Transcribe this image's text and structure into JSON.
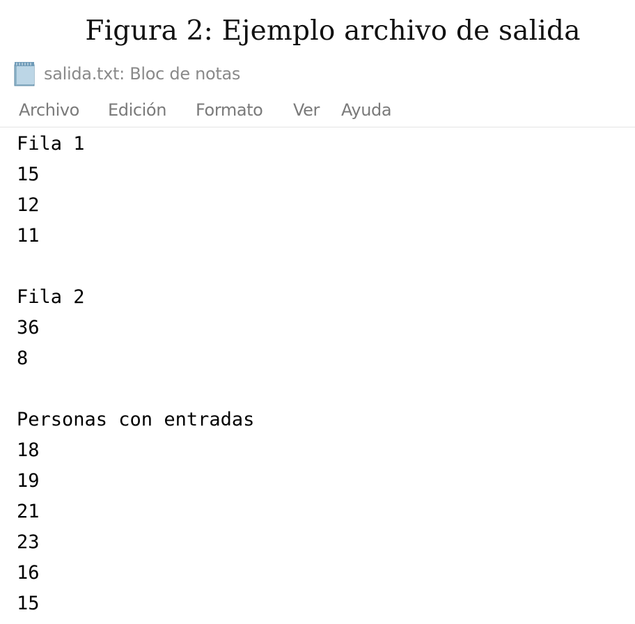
{
  "caption": "Figura 2: Ejemplo archivo de salida",
  "window": {
    "title": "salida.txt: Bloc de notas",
    "icon": "notepad-icon"
  },
  "menu": {
    "items": [
      "Archivo",
      "Edición",
      "Formato",
      "Ver",
      "Ayuda"
    ]
  },
  "document": {
    "lines": [
      "Fila 1",
      "15",
      "12",
      "11",
      "",
      "Fila 2",
      "36",
      "8",
      "",
      "Personas con entradas",
      "18",
      "19",
      "21",
      "23",
      "16",
      "15"
    ]
  }
}
